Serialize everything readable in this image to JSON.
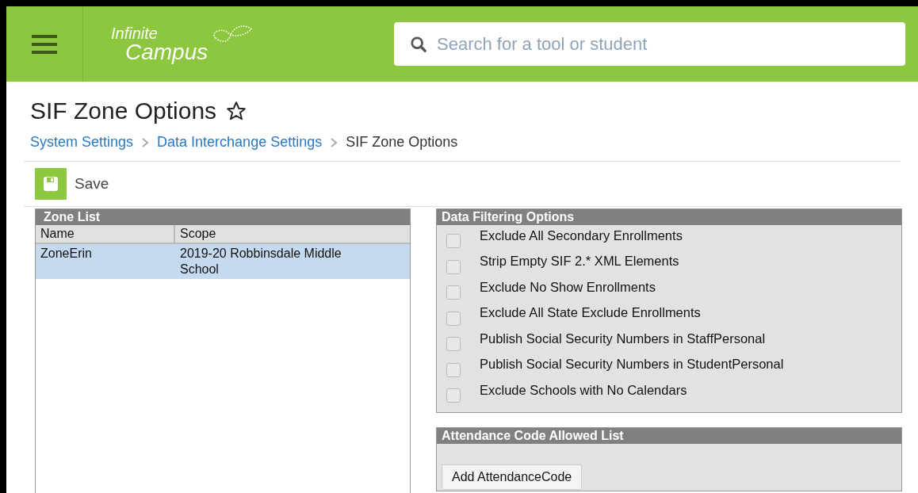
{
  "header": {
    "logo": {
      "line_1": "Infinite",
      "line_2": "Campus"
    },
    "search": {
      "placeholder": "Search for a tool or student"
    }
  },
  "page": {
    "title": "SIF Zone Options",
    "breadcrumb": [
      {
        "label": "System Settings",
        "link": true
      },
      {
        "label": "Data Interchange Settings",
        "link": true
      },
      {
        "label": "SIF Zone Options",
        "link": false
      }
    ]
  },
  "toolbar": {
    "save": "Save"
  },
  "zone_list": {
    "title": "Zone List",
    "columns": [
      "Name",
      "Scope"
    ],
    "rows": [
      {
        "cells": [
          "ZoneErin",
          "2019-20 Robbinsdale Middle School"
        ],
        "selected": true
      }
    ]
  },
  "data_filtering": {
    "title": "Data Filtering Options",
    "options": [
      {
        "label": "Exclude All Secondary Enrollments",
        "checked": false
      },
      {
        "label": "Strip Empty SIF 2.* XML Elements",
        "checked": false
      },
      {
        "label": "Exclude No Show Enrollments",
        "checked": false
      },
      {
        "label": "Exclude All State Exclude Enrollments",
        "checked": false
      },
      {
        "label": "Publish Social Security Numbers in StaffPersonal",
        "checked": false
      },
      {
        "label": "Publish Social Security Numbers in StudentPersonal",
        "checked": false
      },
      {
        "label": "Exclude Schools with No Calendars",
        "checked": false
      }
    ]
  },
  "attendance": {
    "title": "Attendance Code Allowed List",
    "button": "Add AttendanceCode"
  }
}
